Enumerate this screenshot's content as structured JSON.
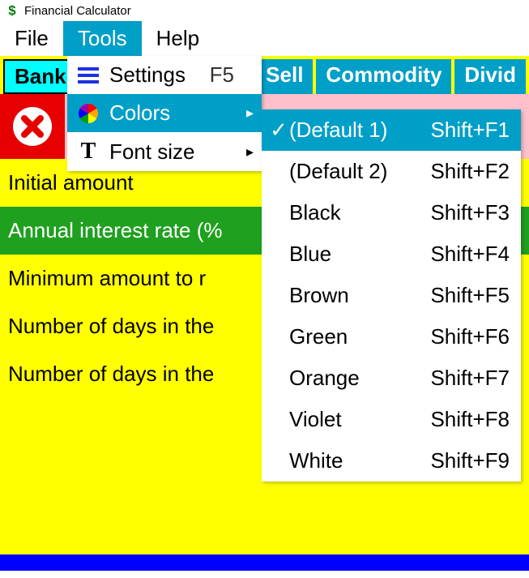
{
  "window": {
    "title": "Financial Calculator"
  },
  "menubar": {
    "file": "File",
    "tools": "Tools",
    "help": "Help"
  },
  "tabs": {
    "bank": "Bank",
    "sell_partial": "d Sell",
    "commodity": "Commodity",
    "dividend_partial": "Divid"
  },
  "tools_menu": {
    "settings": {
      "label": "Settings",
      "shortcut": "F5"
    },
    "colors": {
      "label": "Colors"
    },
    "fontsize": {
      "label": "Font size"
    }
  },
  "colors_menu": {
    "items": [
      {
        "label": "(Default 1)",
        "shortcut": "Shift+F1",
        "checked": true
      },
      {
        "label": "(Default 2)",
        "shortcut": "Shift+F2",
        "checked": false
      },
      {
        "label": "Black",
        "shortcut": "Shift+F3",
        "checked": false
      },
      {
        "label": "Blue",
        "shortcut": "Shift+F4",
        "checked": false
      },
      {
        "label": "Brown",
        "shortcut": "Shift+F5",
        "checked": false
      },
      {
        "label": "Green",
        "shortcut": "Shift+F6",
        "checked": false
      },
      {
        "label": "Orange",
        "shortcut": "Shift+F7",
        "checked": false
      },
      {
        "label": "Violet",
        "shortcut": "Shift+F8",
        "checked": false
      },
      {
        "label": "White",
        "shortcut": "Shift+F9",
        "checked": false
      }
    ]
  },
  "fields": {
    "initial_amount": "Initial amount",
    "annual_rate": "Annual interest rate (%",
    "min_amount": "Minimum amount to r",
    "days_period": "Number of days in the",
    "days_year": "Number of days in the"
  }
}
